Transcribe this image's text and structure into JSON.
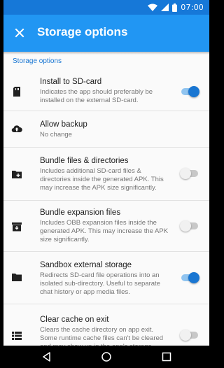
{
  "status_bar": {
    "time": "07:00",
    "icons": [
      "wifi-icon",
      "signal-icon",
      "battery-icon"
    ]
  },
  "app_bar": {
    "title": "Storage options",
    "close_icon": "close-icon",
    "color": "#2196f3",
    "status_color": "#1678d8"
  },
  "section": {
    "header": "Storage options"
  },
  "settings": [
    {
      "icon": "sd-card-icon",
      "title": "Install to SD-card",
      "description": "Indicates the app should preferably be installed on the external SD-card.",
      "toggle": "on"
    },
    {
      "icon": "cloud-upload-icon",
      "title": "Allow backup",
      "description": "No change",
      "toggle": null
    },
    {
      "icon": "add-folder-icon",
      "title": "Bundle files & directories",
      "description": "Includes additional SD-card files & directories inside the generated APK. This may increase the APK size significantly.",
      "toggle": "off"
    },
    {
      "icon": "archive-icon",
      "title": "Bundle expansion files",
      "description": "Includes OBB expansion files inside the generated APK. This may increase the APK size significantly.",
      "toggle": "off"
    },
    {
      "icon": "folder-icon",
      "title": "Sandbox external storage",
      "description": "Redirects SD-card file operations into an isolated sub-directory. Useful to separate chat history or app media files.",
      "toggle": "on"
    },
    {
      "icon": "list-icon",
      "title": "Clear cache on exit",
      "description": "Clears the cache directory on app exit. Some runtime cache files can't be cleared and may show up in the app's storage",
      "toggle": "off"
    }
  ],
  "nav_bar": {
    "buttons": [
      "back-icon",
      "home-icon",
      "recents-icon"
    ]
  },
  "colors": {
    "accent": "#1976d2",
    "toggle_on_track": "#90c4f0",
    "toggle_off_track": "#c8c8c8"
  }
}
